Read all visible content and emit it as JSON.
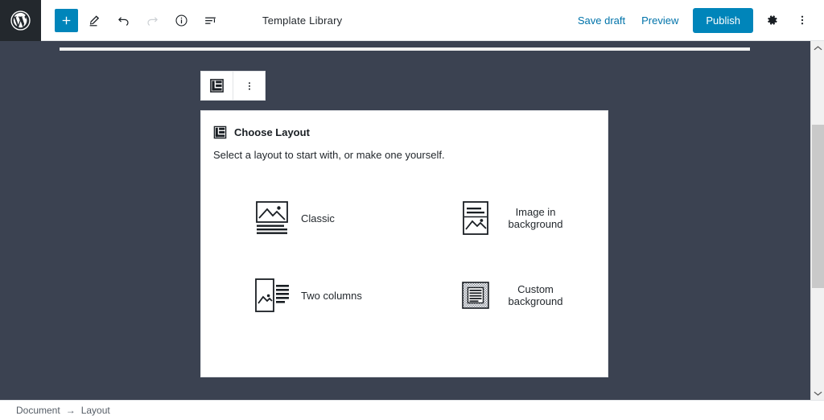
{
  "app": {
    "logo_icon": "wordpress-logo-icon",
    "document_title": "Template Library"
  },
  "toolbar": {
    "add_block_label": "+",
    "add_block_icon": "plus-icon",
    "edit_icon": "pencil-icon",
    "undo_icon": "undo-arrow-icon",
    "redo_icon": "redo-arrow-icon",
    "info_icon": "info-circle-icon",
    "block_navigation_icon": "block-navigation-icon",
    "save_draft_label": "Save draft",
    "preview_label": "Preview",
    "publish_label": "Publish",
    "settings_icon": "gear-icon",
    "more_menu_icon": "kebab-menu-icon",
    "publish_color": "#0085ba",
    "link_color": "#0073aa"
  },
  "block_toolbar": {
    "block_type_icon": "layout-grid-icon",
    "more_options_icon": "kebab-menu-icon"
  },
  "layout_panel": {
    "header_icon": "layout-grid-icon",
    "title": "Choose Layout",
    "subtitle": "Select a layout to start with, or make one yourself.",
    "options": [
      {
        "label": "Classic",
        "icon": "image-over-text-icon",
        "multiline": false
      },
      {
        "label": "Image in background",
        "icon": "text-over-image-icon",
        "multiline": true
      },
      {
        "label": "Two columns",
        "icon": "image-beside-text-icon",
        "multiline": false
      },
      {
        "label": "Custom background",
        "icon": "patterned-background-icon",
        "multiline": true
      }
    ]
  },
  "scrollbar": {
    "up_arrow_icon": "chevron-up-icon",
    "down_arrow_icon": "chevron-down-icon",
    "thumb_name": "scrollbar-thumb"
  },
  "statusbar": {
    "breadcrumb": [
      "Document",
      "Layout"
    ],
    "separator": "→"
  },
  "canvas": {
    "background_color": "#3b4251"
  }
}
